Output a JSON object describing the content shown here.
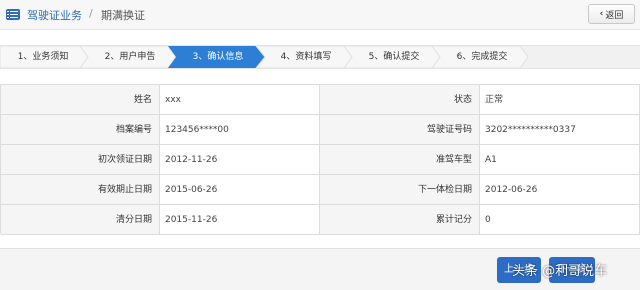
{
  "header": {
    "breadcrumb_root": "驾驶证业务",
    "breadcrumb_sep": "/",
    "breadcrumb_current": "期满换证",
    "back_label": "返回",
    "icon": "list-icon"
  },
  "steps": [
    {
      "label": "1、业务须知",
      "state": "done"
    },
    {
      "label": "2、用户申告",
      "state": "done"
    },
    {
      "label": "3、确认信息",
      "state": "active"
    },
    {
      "label": "4、资料填写",
      "state": "todo"
    },
    {
      "label": "5、确认提交",
      "state": "todo"
    },
    {
      "label": "6、完成提交",
      "state": "todo"
    }
  ],
  "info": [
    {
      "l1": "姓名",
      "v1": "xxx",
      "l2": "状态",
      "v2": "正常"
    },
    {
      "l1": "档案编号",
      "v1": "123456****00",
      "l2": "驾驶证号码",
      "v2": "3202**********0337"
    },
    {
      "l1": "初次领证日期",
      "v1": "2012-11-26",
      "l2": "准驾车型",
      "v2": "A1"
    },
    {
      "l1": "有效期止日期",
      "v1": "2015-06-26",
      "l2": "下一体检日期",
      "v2": "2012-06-26"
    },
    {
      "l1": "清分日期",
      "v1": "2015-11-26",
      "l2": "累计记分",
      "v2": "0"
    }
  ],
  "footer": {
    "prev_label": "上一步",
    "next_label": "下一步"
  },
  "watermark": "头条 @利哥说车",
  "colors": {
    "accent": "#2f6db5",
    "step_active": "#2d7fd6",
    "button": "#2d6cc4"
  }
}
